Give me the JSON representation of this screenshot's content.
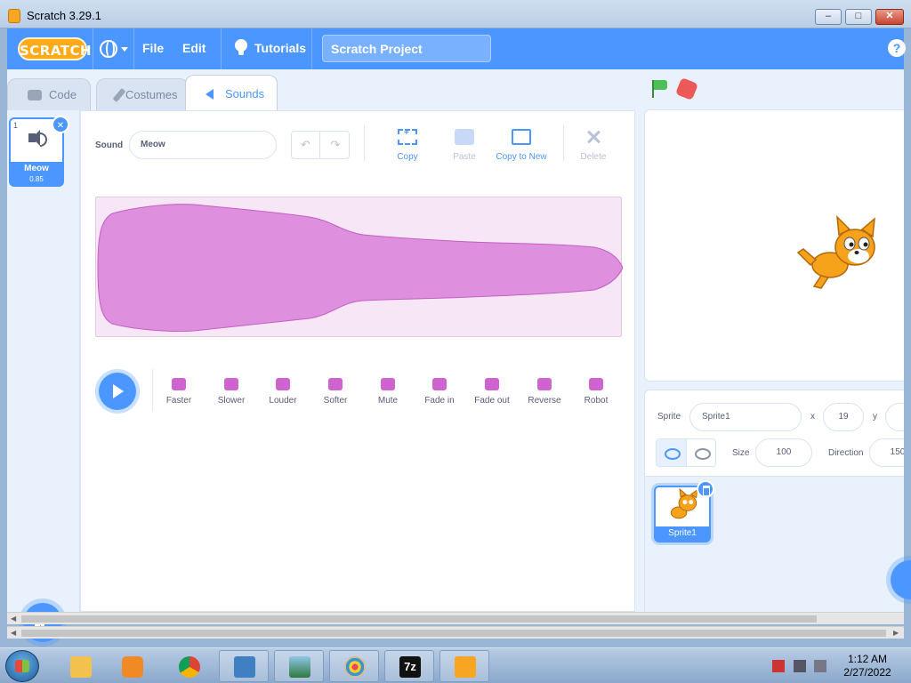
{
  "window": {
    "title": "Scratch 3.29.1",
    "minimize_glyph": "–",
    "maximize_glyph": "□",
    "close_glyph": "✕"
  },
  "menubar": {
    "logo": "SCRATCH",
    "file": "File",
    "edit": "Edit",
    "tutorials": "Tutorials",
    "project_title": "Scratch Project",
    "help": "?"
  },
  "tabs": [
    {
      "label": "Code",
      "icon": "code-icon"
    },
    {
      "label": "Costumes",
      "icon": "brush-icon"
    },
    {
      "label": "Sounds",
      "icon": "sound-icon",
      "active": true
    }
  ],
  "sound_list": [
    {
      "number": "1",
      "name": "Meow",
      "duration": "0.85",
      "selected": true
    }
  ],
  "editor": {
    "sound_label": "Sound",
    "sound_name": "Meow",
    "undo_glyph": "↶",
    "redo_glyph": "↷",
    "tools": [
      {
        "label": "Copy",
        "enabled": true
      },
      {
        "label": "Paste",
        "enabled": false
      },
      {
        "label": "Copy to New",
        "enabled": true
      },
      {
        "label": "Delete",
        "enabled": false
      }
    ],
    "effects": [
      "Faster",
      "Slower",
      "Louder",
      "Softer",
      "Mute",
      "Fade in",
      "Fade out",
      "Reverse",
      "Robot"
    ]
  },
  "sprite_info": {
    "sprite_label": "Sprite",
    "sprite_name": "Sprite1",
    "x_label": "x",
    "x_value": "19",
    "y_label": "y",
    "y_value": "-",
    "size_label": "Size",
    "size_value": "100",
    "direction_label": "Direction",
    "direction_value": "150"
  },
  "sprites": [
    {
      "name": "Sprite1",
      "selected": true
    }
  ],
  "taskbar": {
    "time": "1:12 AM",
    "date": "2/27/2022",
    "apps": [
      "explorer-icon",
      "media-player-icon",
      "chrome-icon",
      "control-panel-icon",
      "image-viewer-icon",
      "paint-icon",
      "7zip-icon",
      "scratch-icon"
    ],
    "seven_zip": "7z"
  },
  "colors": {
    "accent": "#4c97ff",
    "sound_purple": "#cf63cf",
    "waveform_bg": "#f6e6f6"
  }
}
